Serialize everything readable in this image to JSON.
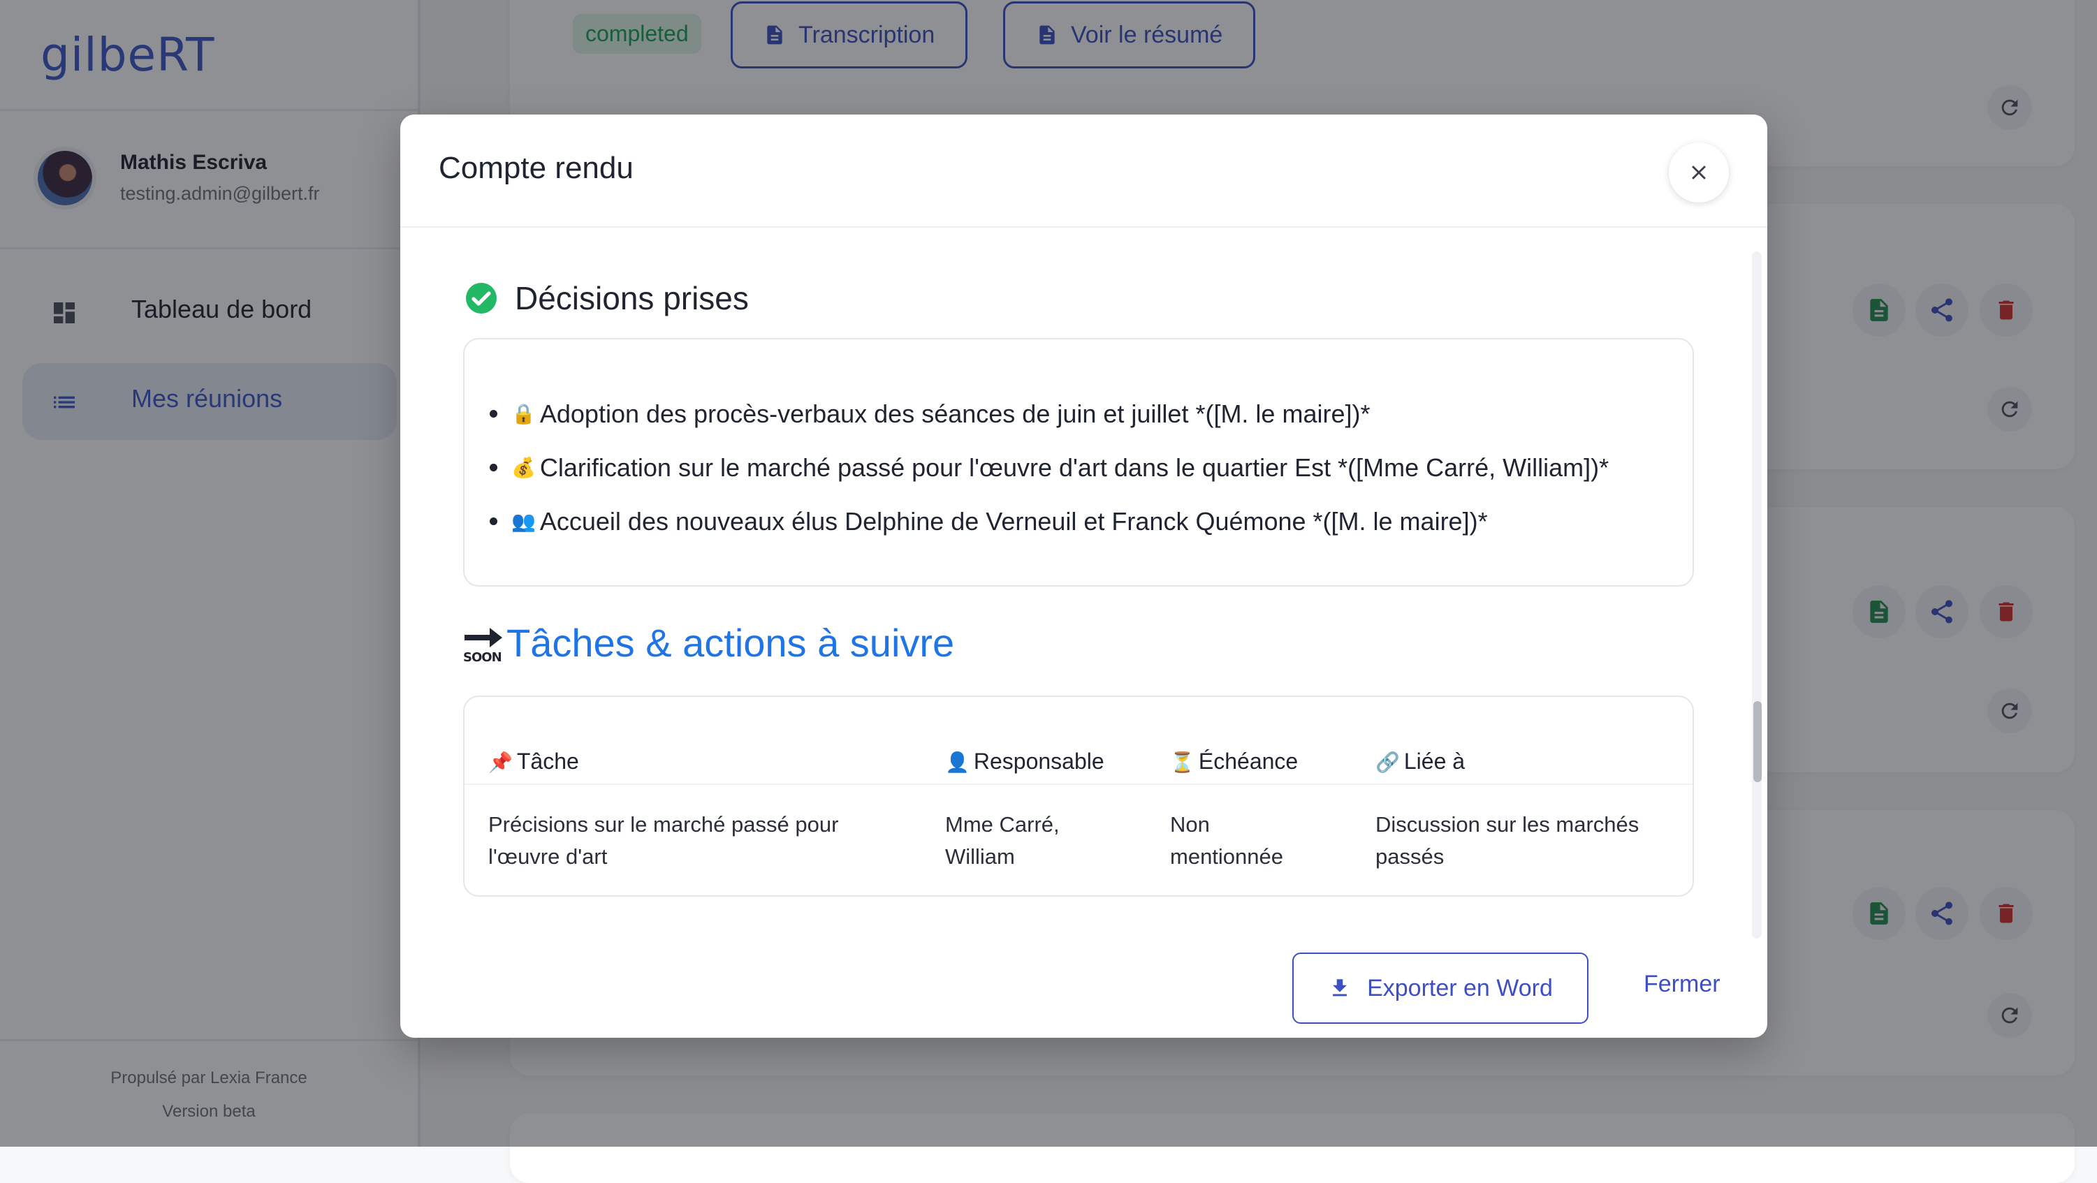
{
  "app": {
    "logo": "gilbeRT"
  },
  "user": {
    "name": "Mathis Escriva",
    "email": "testing.admin@gilbert.fr"
  },
  "nav": {
    "items": [
      {
        "label": "Tableau de bord",
        "icon": "dashboard-icon",
        "active": false
      },
      {
        "label": "Mes réunions",
        "icon": "list-icon",
        "active": true
      }
    ]
  },
  "footer": {
    "powered": "Propulsé par Lexia France",
    "version": "Version beta"
  },
  "background": {
    "status_badge": "completed",
    "transcription_button": "Transcription",
    "summary_button": "Voir le résumé"
  },
  "modal": {
    "title": "Compte rendu",
    "decisions": {
      "heading": "Décisions prises",
      "items": [
        {
          "emoji": "🔒",
          "text": "Adoption des procès-verbaux des séances de juin et juillet *([M. le maire])*"
        },
        {
          "emoji": "💰",
          "text": "Clarification sur le marché passé pour l'œuvre d'art dans le quartier Est *([Mme Carré, William])*"
        },
        {
          "emoji": "👥",
          "text": "Accueil des nouveaux élus Delphine de Verneuil et Franck Quémone *([M. le maire])*"
        }
      ]
    },
    "tasks": {
      "soon_label": "SOON",
      "heading": "Tâches & actions à suivre",
      "headers": [
        {
          "emoji": "📌",
          "label": "Tâche"
        },
        {
          "emoji": "👤",
          "label": "Responsable"
        },
        {
          "emoji": "⏳",
          "label": "Échéance"
        },
        {
          "emoji": "🔗",
          "label": "Liée à"
        }
      ],
      "rows": [
        {
          "task": "Précisions sur le marché passé pour l'œuvre d'art",
          "owner": "Mme Carré, William",
          "due": "Non mentionnée",
          "linked": "Discussion sur les marchés passés"
        }
      ]
    },
    "export_button": "Exporter en Word",
    "close_link": "Fermer"
  },
  "colors": {
    "accent": "#3d4fc2",
    "link_blue": "#1f74e6",
    "success": "#18a155",
    "danger": "#d32f2f"
  }
}
